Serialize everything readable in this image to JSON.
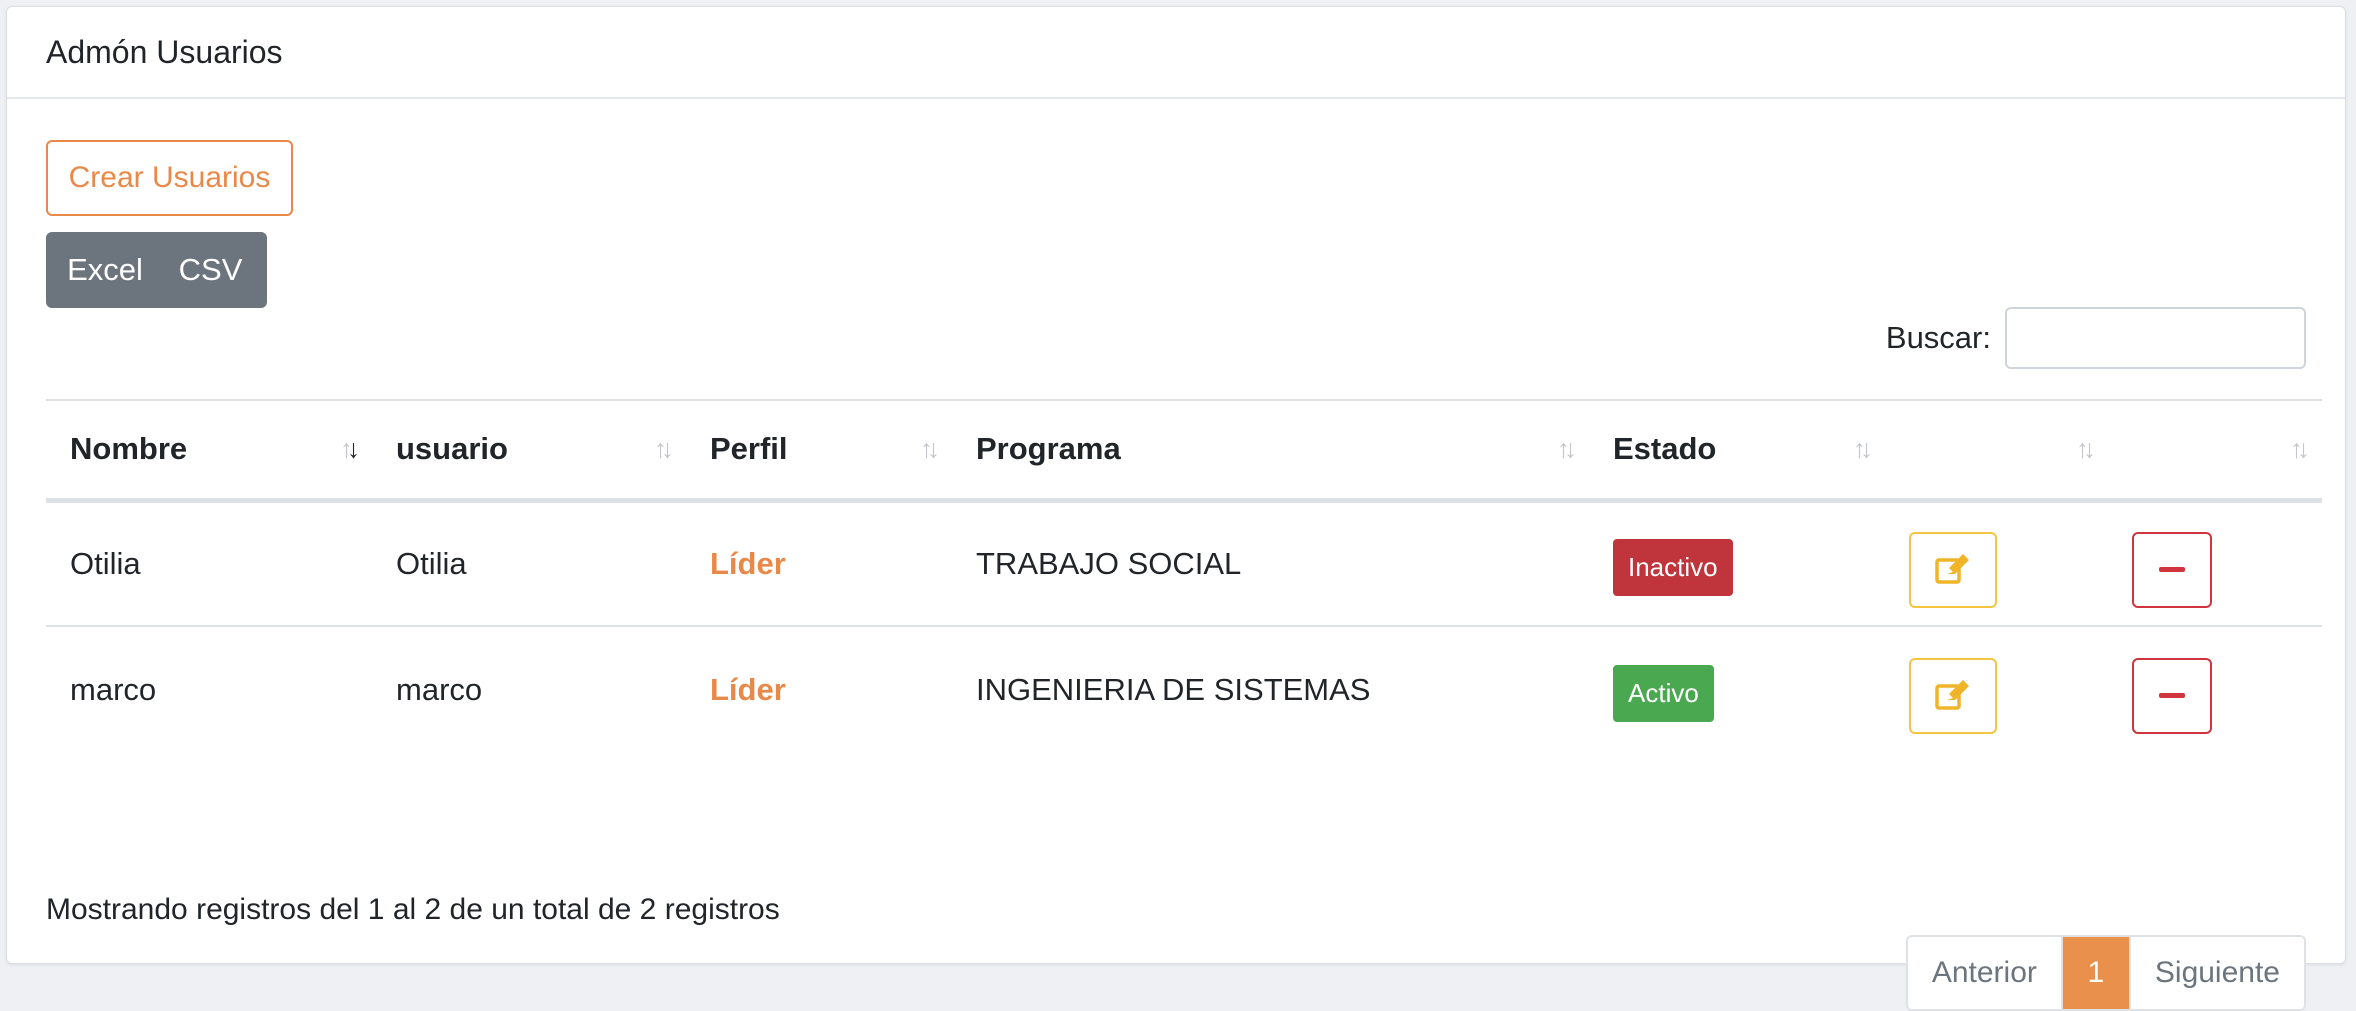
{
  "header": {
    "title": "Admón Usuarios"
  },
  "actions": {
    "create_label": "Crear Usuarios",
    "excel_label": "Excel",
    "csv_label": "CSV"
  },
  "search": {
    "label": "Buscar:",
    "value": "",
    "placeholder": ""
  },
  "table": {
    "columns": [
      "Nombre",
      "usuario",
      "Perfil",
      "Programa",
      "Estado",
      "",
      ""
    ],
    "sorted_column": "Nombre",
    "rows": [
      {
        "nombre": "Otilia",
        "usuario": "Otilia",
        "perfil": "Líder",
        "programa": "TRABAJO SOCIAL",
        "estado": "Inactivo",
        "estado_color": "#c0353b"
      },
      {
        "nombre": "marco",
        "usuario": "marco",
        "perfil": "Líder",
        "programa": "INGENIERIA DE SISTEMAS",
        "estado": "Activo",
        "estado_color": "#4aa850"
      }
    ]
  },
  "footer": {
    "info": "Mostrando registros del 1 al 2 de un total de 2 registros",
    "prev_label": "Anterior",
    "current_page": "1",
    "next_label": "Siguiente"
  },
  "colors": {
    "accent": "#e8894a",
    "edit": "#f5c542",
    "delete": "#d0353d",
    "export": "#6c757d"
  },
  "icons": {
    "edit": "pencil-square-icon",
    "delete": "minus-icon",
    "sort": "sort-arrows-icon"
  }
}
